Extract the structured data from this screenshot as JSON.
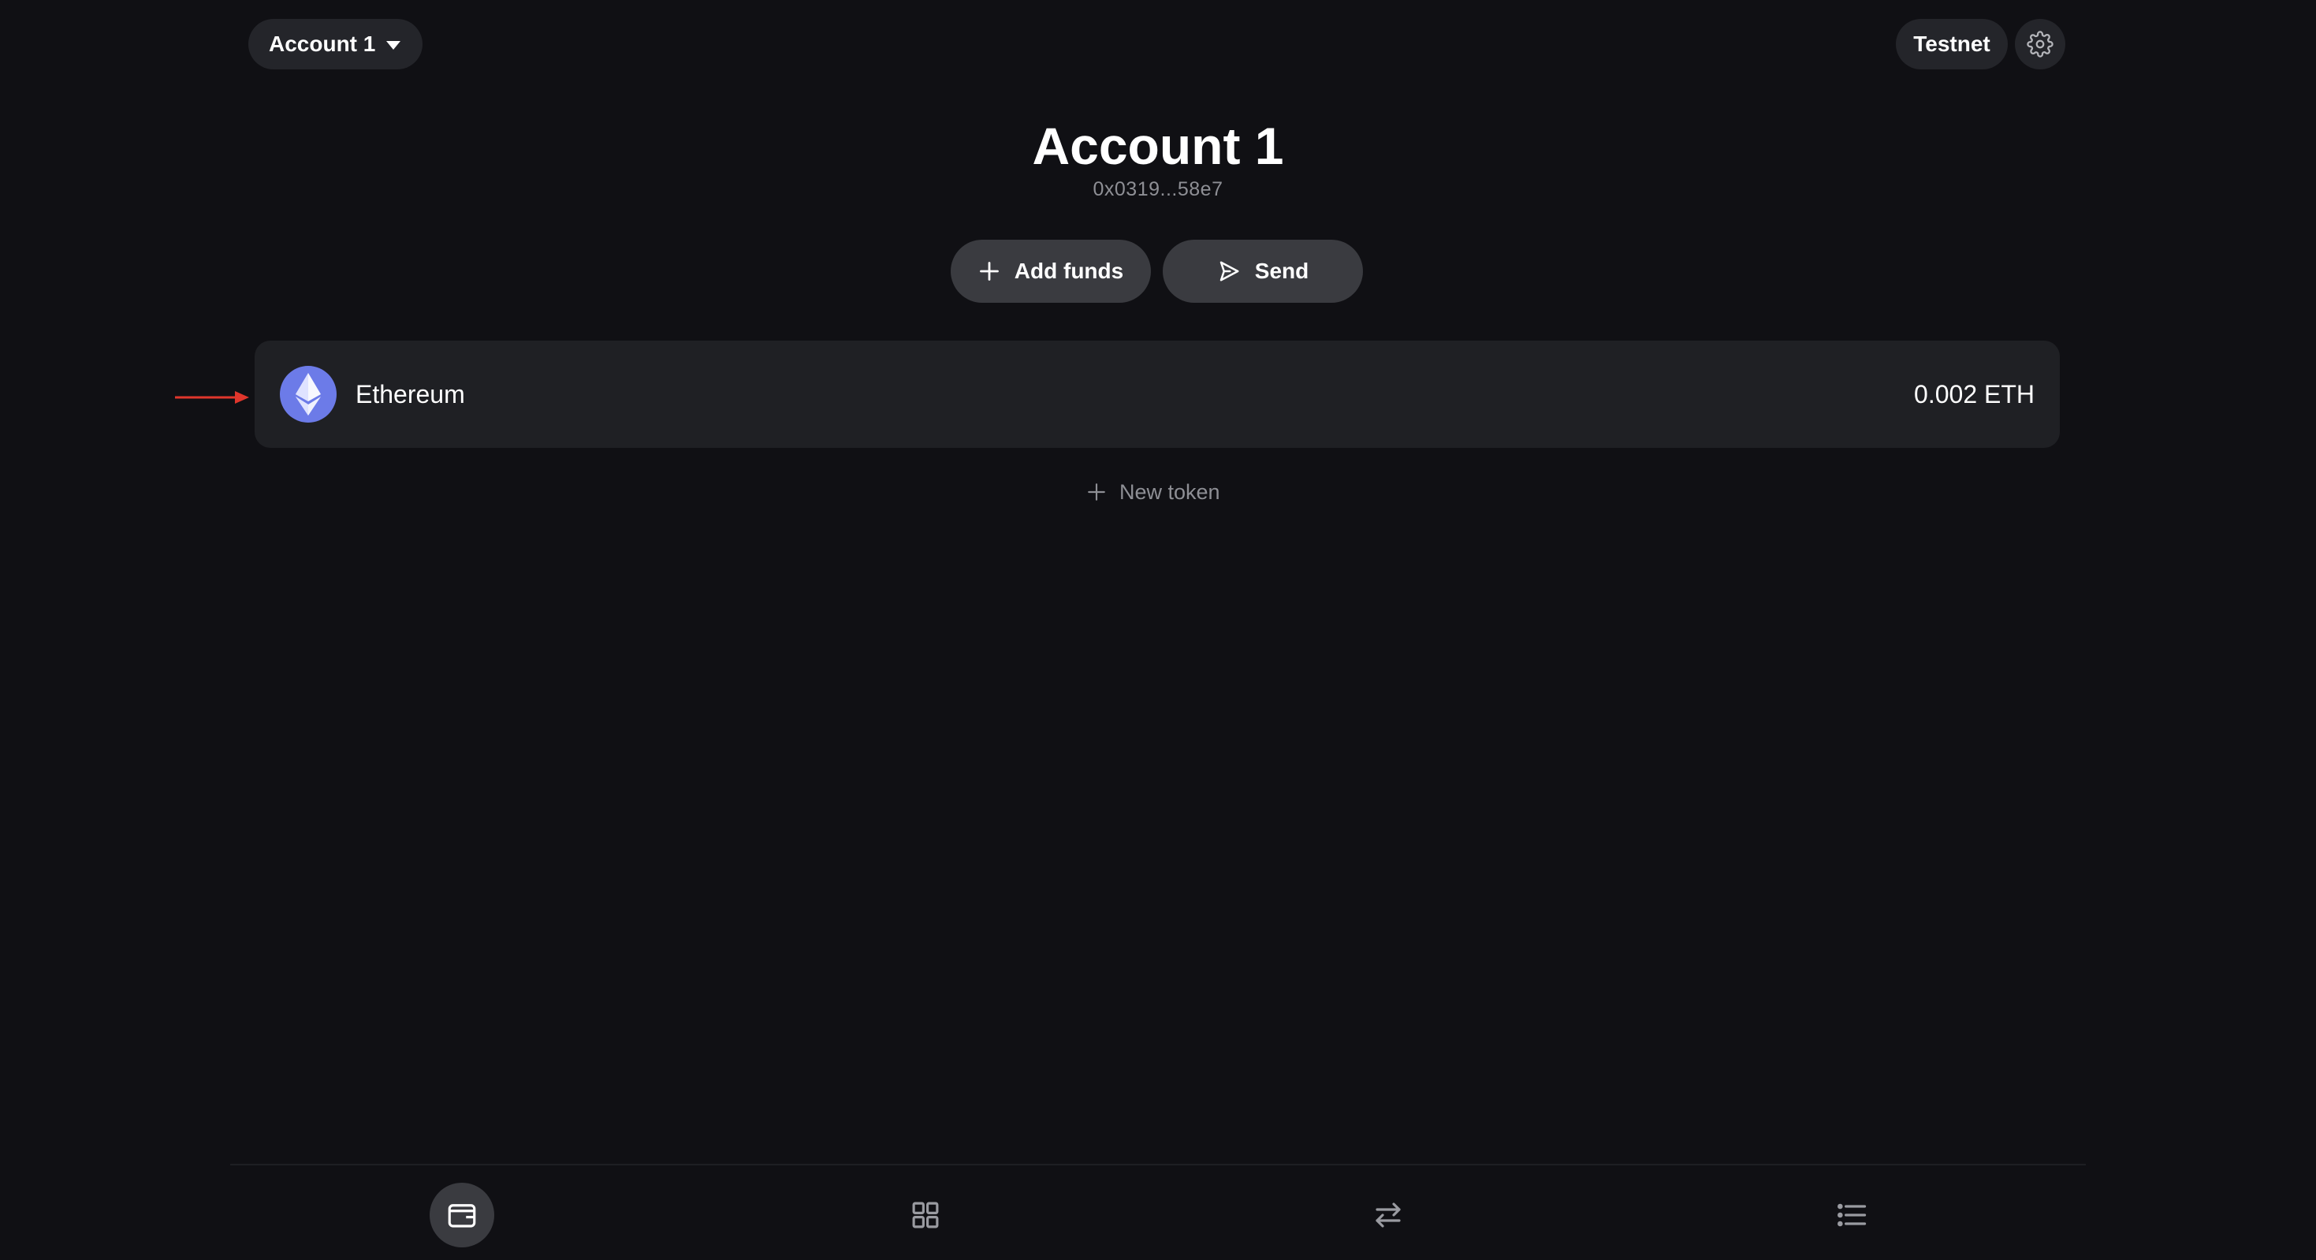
{
  "topbar": {
    "account_label": "Account 1",
    "network_label": "Testnet",
    "settings_icon": "gear-icon"
  },
  "header": {
    "title": "Account 1",
    "address": "0x0319...58e7"
  },
  "actions": {
    "add_funds_label": "Add funds",
    "send_label": "Send"
  },
  "tokens": [
    {
      "name": "Ethereum",
      "balance": "0.002 ETH",
      "icon": "ethereum-icon"
    }
  ],
  "new_token_label": "New token",
  "bottom_nav": [
    {
      "id": "wallet",
      "icon": "wallet-icon",
      "active": true
    },
    {
      "id": "apps",
      "icon": "grid-icon",
      "active": false
    },
    {
      "id": "swap",
      "icon": "swap-arrows-icon",
      "active": false
    },
    {
      "id": "activity",
      "icon": "list-icon",
      "active": false
    }
  ],
  "colors": {
    "background": "#101014",
    "surface": "#1f2024",
    "button": "#3a3b40",
    "muted_text": "#8e8f95",
    "ethereum_logo": "#6c7be8",
    "annotation_arrow": "#e0362c"
  }
}
